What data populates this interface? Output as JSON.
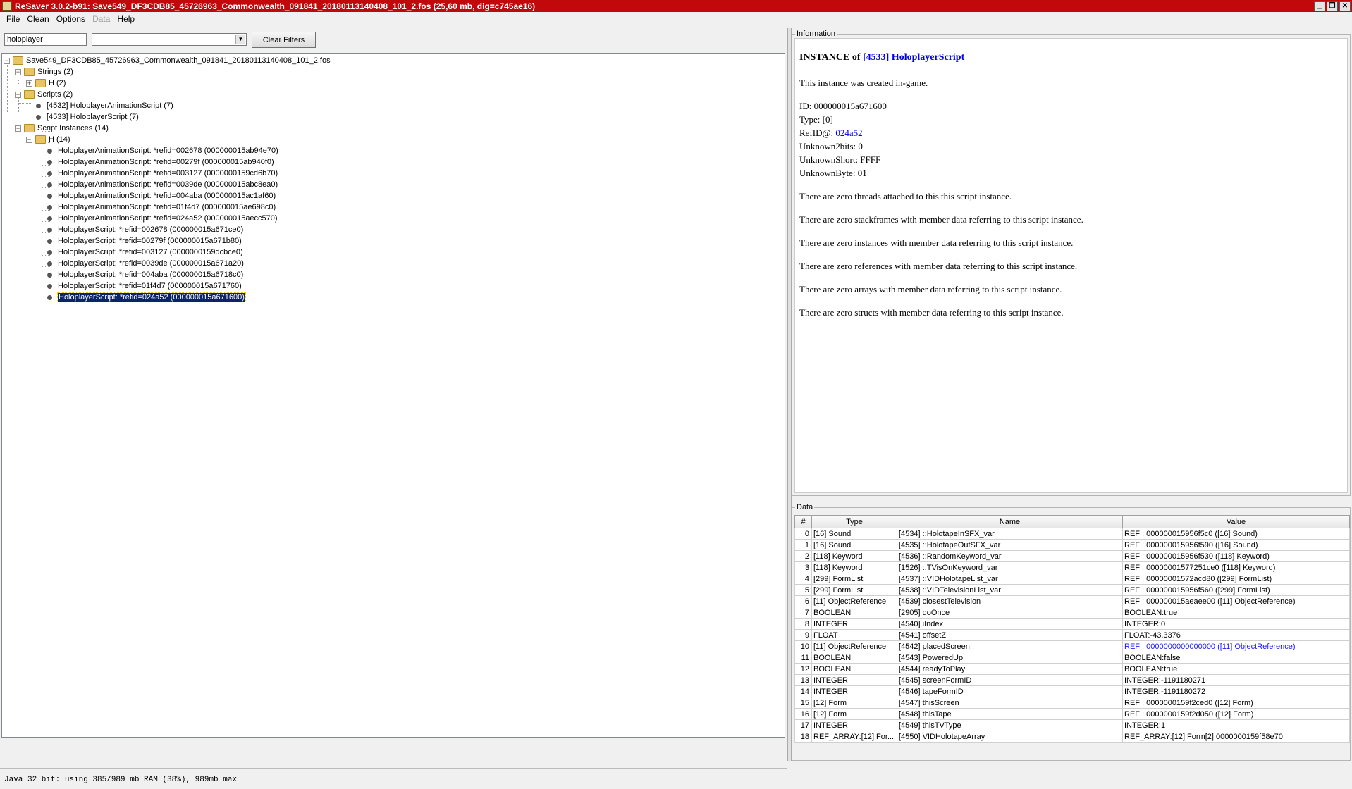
{
  "window": {
    "title": "ReSaver 3.0.2-b91: Save549_DF3CDB85_45726963_Commonwealth_091841_20180113140408_101_2.fos (25,60 mb, dig=c745ae16)",
    "minimize": "_",
    "restore": "❐",
    "close": "✕"
  },
  "menu": [
    "File",
    "Clean",
    "Options",
    "Data",
    "Help"
  ],
  "filter": {
    "text": "holoplayer",
    "combo_value": "",
    "clear_label": "Clear Filters"
  },
  "tree": {
    "root": "Save549_DF3CDB85_45726963_Commonwealth_091841_20180113140408_101_2.fos",
    "strings": "Strings (2)",
    "strings_h": "H (2)",
    "scripts": "Scripts (2)",
    "script_items": [
      "[4532] HoloplayerAnimationScript (7)",
      "[4533] HoloplayerScript (7)"
    ],
    "instances": "Script Instances (14)",
    "instances_h": "H (14)",
    "instance_items": [
      "HoloplayerAnimationScript: *refid=002678 (000000015ab94e70)",
      "HoloplayerAnimationScript: *refid=00279f (000000015ab940f0)",
      "HoloplayerAnimationScript: *refid=003127 (0000000159cd6b70)",
      "HoloplayerAnimationScript: *refid=0039de (000000015abc8ea0)",
      "HoloplayerAnimationScript: *refid=004aba (000000015ac1af60)",
      "HoloplayerAnimationScript: *refid=01f4d7 (000000015ae698c0)",
      "HoloplayerAnimationScript: *refid=024a52 (000000015aecc570)",
      "HoloplayerScript: *refid=002678 (000000015a671ce0)",
      "HoloplayerScript: *refid=00279f (000000015a671b80)",
      "HoloplayerScript: *refid=003127 (0000000159dcbce0)",
      "HoloplayerScript: *refid=0039de (000000015a671a20)",
      "HoloplayerScript: *refid=004aba (000000015a6718c0)",
      "HoloplayerScript: *refid=01f4d7 (000000015a671760)",
      "HoloplayerScript: *refid=024a52 (000000015a671600)"
    ]
  },
  "status": "Java 32 bit: using 385/989 mb RAM (38%), 989mb max",
  "information": {
    "legend": "Information",
    "title_prefix": "INSTANCE of ",
    "title_link": "[4533] HoloplayerScript",
    "created": "This instance was created in-game.",
    "id": "ID: 000000015a671600",
    "type": "Type: [0]",
    "refid_label": "RefID@: ",
    "refid_link": "024a52",
    "unknown2bits": "Unknown2bits: 0",
    "unknownshort": "UnknownShort: FFFF",
    "unknownbyte": "UnknownByte: 01",
    "paragraphs": [
      "There are zero threads attached to this this script instance.",
      "There are zero stackframes with member data referring to this script instance.",
      "There are zero instances with member data referring to this script instance.",
      "There are zero references with member data referring to this script instance.",
      "There are zero arrays with member data referring to this script instance.",
      "There are zero structs with member data referring to this script instance."
    ]
  },
  "data": {
    "legend": "Data",
    "headers": [
      "#",
      "Type",
      "Name",
      "Value"
    ],
    "rows": [
      [
        "0",
        "[16] Sound",
        "[4534] ::HolotapeInSFX_var",
        "REF : 000000015956f5c0 ([16] Sound)"
      ],
      [
        "1",
        "[16] Sound",
        "[4535] ::HolotapeOutSFX_var",
        "REF : 000000015956f590 ([16] Sound)"
      ],
      [
        "2",
        "[118] Keyword",
        "[4536] ::RandomKeyword_var",
        "REF : 000000015956f530 ([118] Keyword)"
      ],
      [
        "3",
        "[118] Keyword",
        "[1526] ::TVisOnKeyword_var",
        "REF : 00000001577251ce0 ([118] Keyword)"
      ],
      [
        "4",
        "[299] FormList",
        "[4537] ::VIDHolotapeList_var",
        "REF : 00000001572acd80 ([299] FormList)"
      ],
      [
        "5",
        "[299] FormList",
        "[4538] ::VIDTelevisionList_var",
        "REF : 000000015956f560 ([299] FormList)"
      ],
      [
        "6",
        "[11] ObjectReference",
        "[4539] closestTelevision",
        "REF : 000000015aeaee00 ([11] ObjectReference)"
      ],
      [
        "7",
        "BOOLEAN",
        "[2905] doOnce",
        "BOOLEAN:true"
      ],
      [
        "8",
        "INTEGER",
        "[4540] iIndex",
        "INTEGER:0"
      ],
      [
        "9",
        "FLOAT",
        "[4541] offsetZ",
        "FLOAT:-43.3376"
      ],
      [
        "10",
        "[11] ObjectReference",
        "[4542] placedScreen",
        "REF : 0000000000000000 ([11] ObjectReference)"
      ],
      [
        "11",
        "BOOLEAN",
        "[4543] PoweredUp",
        "BOOLEAN:false"
      ],
      [
        "12",
        "BOOLEAN",
        "[4544] readyToPlay",
        "BOOLEAN:true"
      ],
      [
        "13",
        "INTEGER",
        "[4545] screenFormID",
        "INTEGER:-1191180271"
      ],
      [
        "14",
        "INTEGER",
        "[4546] tapeFormID",
        "INTEGER:-1191180272"
      ],
      [
        "15",
        "[12] Form",
        "[4547] thisScreen",
        "REF : 0000000159f2ced0 ([12] Form)"
      ],
      [
        "16",
        "[12] Form",
        "[4548] thisTape",
        "REF : 0000000159f2d050 ([12] Form)"
      ],
      [
        "17",
        "INTEGER",
        "[4549] thisTVType",
        "INTEGER:1"
      ],
      [
        "18",
        "REF_ARRAY:[12] For...",
        "[4550] VIDHolotapeArray",
        "REF_ARRAY:[12] Form[2] 0000000159f58e70"
      ]
    ]
  }
}
